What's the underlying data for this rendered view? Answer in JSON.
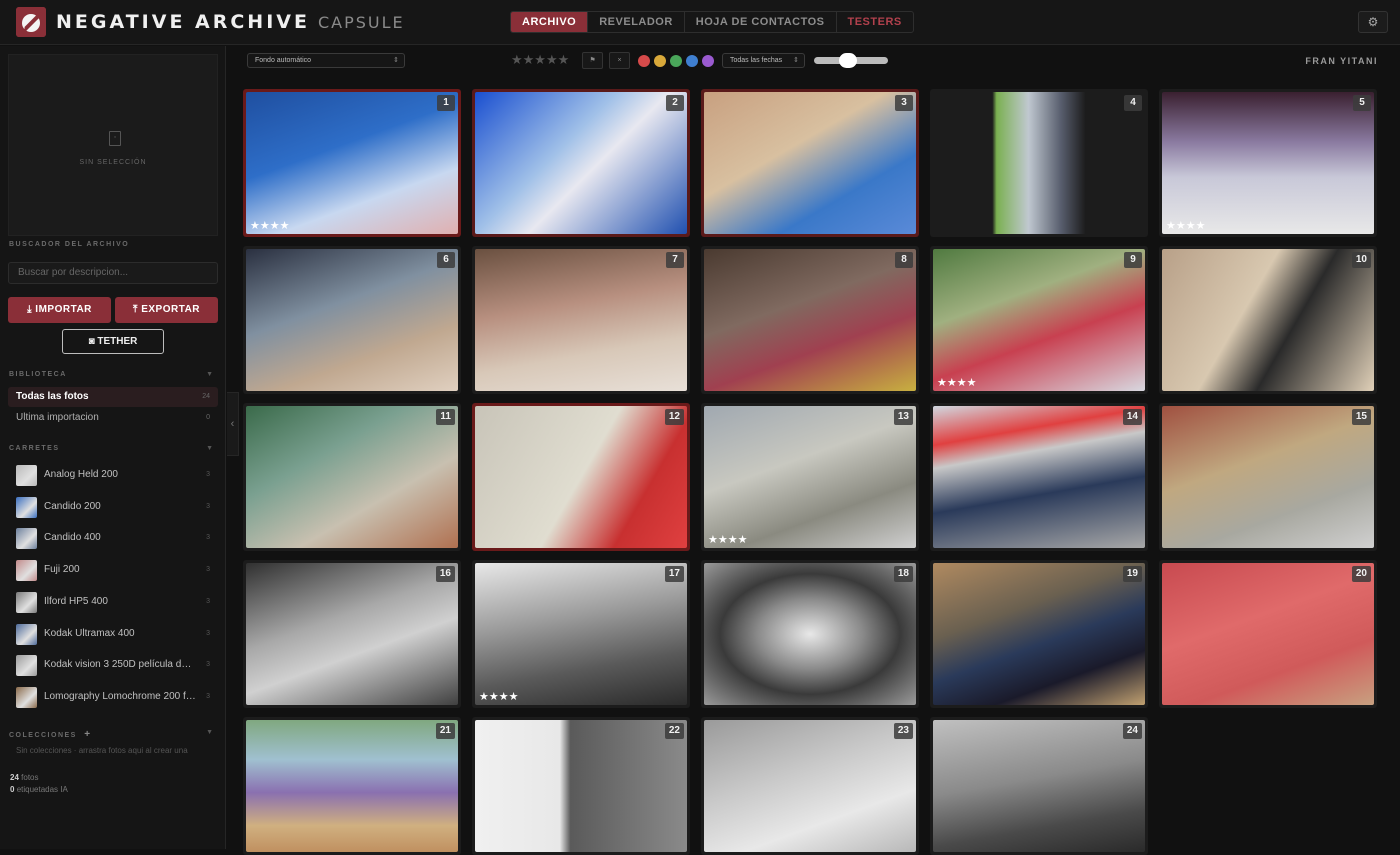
{
  "app": {
    "brand": "NEGATIVE ARCHIVE",
    "brand_sub": "CAPSULE"
  },
  "nav": {
    "tabs": [
      {
        "label": "ARCHIVO",
        "state": "active"
      },
      {
        "label": "REVELADOR",
        "state": "normal"
      },
      {
        "label": "HOJA DE CONTACTOS",
        "state": "normal"
      },
      {
        "label": "TESTERS",
        "state": "alert"
      }
    ]
  },
  "header": {
    "settings_icon": "⚙"
  },
  "sidebar": {
    "preview": {
      "empty_text": "SIN SELECCIÓN"
    },
    "search": {
      "label": "BUSCADOR DEL ARCHIVO",
      "placeholder": "Buscar por descripcion..."
    },
    "buttons": {
      "import": "IMPORTAR",
      "export": "EXPORTAR",
      "tether": "TETHER"
    },
    "library": {
      "label": "BIBLIOTECA",
      "items": [
        {
          "label": "Todas las fotos",
          "count": "24"
        },
        {
          "label": "Ultima importacion",
          "count": "0"
        }
      ]
    },
    "rolls": {
      "label": "CARRETES",
      "items": [
        {
          "name": "Analog Held 200",
          "count": "3",
          "color": "#b9b9b9"
        },
        {
          "name": "Candido 200",
          "count": "3",
          "color": "#3a6fc0"
        },
        {
          "name": "Candido 400",
          "count": "3",
          "color": "#6b7f9c"
        },
        {
          "name": "Fuji 200",
          "count": "3",
          "color": "#c28a8a"
        },
        {
          "name": "Ilford HP5 400",
          "count": "3",
          "color": "#7a7a7a"
        },
        {
          "name": "Kodak Ultramax 400",
          "count": "3",
          "color": "#4d6a9a"
        },
        {
          "name": "Kodak vision 3 250D película de cine",
          "count": "3",
          "color": "#9a9a9a"
        },
        {
          "name": "Lomography Lomochrome 200 formato 120",
          "count": "3",
          "color": "#8a6a4a"
        }
      ]
    },
    "collections": {
      "label": "COLECCIONES",
      "add": "+",
      "empty": "Sin colecciones · arrastra fotos aqui al crear una"
    },
    "stats": {
      "photos_count": "24",
      "photos_label": "fotos",
      "tagged_count": "0",
      "tagged_label": "etiquetadas IA"
    }
  },
  "toolbar": {
    "background_select": "Fondo automático",
    "stars": "★★★★★",
    "flag_icon": "⚑",
    "clear_icon": "×",
    "color_labels": [
      "#d64a4a",
      "#d9a93a",
      "#4aa65a",
      "#3f7fd0",
      "#9a5ad0"
    ],
    "date_select": "Todas las fechas",
    "zoom": 0.45,
    "user": "FRAN YITANI"
  },
  "photos": [
    {
      "n": "1",
      "rating": "★★★★",
      "bg": "linear-gradient(160deg,#1f4fa0 0%,#2e6ec8 40%,#c8d8f0 70%,#e0b0b0 100%)",
      "border": "#6a1a1a"
    },
    {
      "n": "2",
      "rating": "",
      "bg": "linear-gradient(135deg,#1a4fd0 0%,#a0c0e8 40%,#e8e8f0 55%,#2050b0 100%)",
      "border": "#5a1a1a"
    },
    {
      "n": "3",
      "rating": "",
      "bg": "linear-gradient(150deg,#c8a080 0%,#d8c0a0 40%,#3a78c8 70%,#5a8ad8 100%)",
      "border": "#5a1a1a"
    },
    {
      "n": "4",
      "rating": "",
      "bg": "linear-gradient(90deg,#1c1c1c 0%,#1c1c1c 28%,#7ab050 30%,#c0c8d0 45%,#5a6070 60%,#1c1c1c 72%,#1c1c1c 100%)",
      "border": "#1c1c1c"
    },
    {
      "n": "5",
      "rating": "★★★★",
      "bg": "linear-gradient(180deg,#3a2030 0%,#8a7aa0 35%,#c8c8d8 60%,#e8e8e8 100%)",
      "border": "#1c1c1c"
    },
    {
      "n": "6",
      "rating": "",
      "bg": "linear-gradient(160deg,#2a3040 0%,#8090a0 40%,#c0a890 70%,#e0d0c0 100%)",
      "border": "#1c1c1c"
    },
    {
      "n": "7",
      "rating": "",
      "bg": "linear-gradient(170deg,#6a5040 0%,#b89080 40%,#d8c8b8 70%,#e8e0d8 100%)",
      "border": "#1c1c1c"
    },
    {
      "n": "8",
      "rating": "",
      "bg": "linear-gradient(160deg,#4a3a30 0%,#806a60 40%,#a04050 65%,#c8b040 100%)",
      "border": "#1c1c1c"
    },
    {
      "n": "9",
      "rating": "★★★★",
      "bg": "linear-gradient(160deg,#507a40 0%,#a0b080 35%,#c84050 60%,#d8d8e0 100%)",
      "border": "#1c1c1c"
    },
    {
      "n": "10",
      "rating": "",
      "bg": "linear-gradient(120deg,#b8a088 0%,#d8c8b0 40%,#2a2a2a 60%,#e0d0b8 100%)",
      "border": "#1c1c1c"
    },
    {
      "n": "11",
      "rating": "",
      "bg": "linear-gradient(150deg,#3a6a4a 0%,#7aa090 35%,#c8c0b0 65%,#b07050 100%)",
      "border": "#1c1c1c"
    },
    {
      "n": "12",
      "rating": "",
      "bg": "linear-gradient(120deg,#c8c4b8 0%,#e0ddd0 50%,#c83030 75%,#e04040 100%)",
      "border": "#6a1a1a"
    },
    {
      "n": "13",
      "rating": "★★★★",
      "bg": "linear-gradient(160deg,#a0a8b0 0%,#c8c8c0 40%,#8a8a80 70%,#d0d0d0 100%)",
      "border": "#1c1c1c"
    },
    {
      "n": "14",
      "rating": "",
      "bg": "linear-gradient(170deg,#d0d8e0 0%,#e04040 22%,#c8c8c8 35%,#2a3a5a 60%,#a8a8a8 100%)",
      "border": "#1c1c1c"
    },
    {
      "n": "15",
      "rating": "",
      "bg": "linear-gradient(160deg,#a05040 0%,#c0a880 40%,#a8a8a0 70%,#d0d0d0 100%)",
      "border": "#1c1c1c"
    },
    {
      "n": "16",
      "rating": "",
      "bg": "linear-gradient(160deg,#303030 0%,#a8a8a8 40%,#d0d0d0 60%,#404040 100%)",
      "border": "#1c1c1c"
    },
    {
      "n": "17",
      "rating": "★★★★",
      "bg": "linear-gradient(170deg,#e8e8e8 0%,#9a9a9a 40%,#5a5a5a 70%,#2a2a2a 100%)",
      "border": "#1c1c1c"
    },
    {
      "n": "18",
      "rating": "",
      "bg": "radial-gradient(ellipse at 50% 50%,#e8e8e8 0%,#8a8a8a 35%,#3a3a3a 60%,#9a9a9a 100%)",
      "border": "#1c1c1c"
    },
    {
      "n": "19",
      "rating": "",
      "bg": "linear-gradient(160deg,#b08a60 0%,#6a6050 35%,#2a3a5a 55%,#1a1a2a 75%,#c0a070 100%)",
      "border": "#1c1c1c"
    },
    {
      "n": "20",
      "rating": "",
      "bg": "linear-gradient(160deg,#c84a50 0%,#e06a6a 40%,#d05a5a 70%,#c8a080 100%)",
      "border": "#1c1c1c"
    },
    {
      "n": "21",
      "rating": "",
      "bg": "linear-gradient(180deg,#80a880 0%,#a0c0d0 30%,#8a70b0 55%,#d0b080 80%,#c09060 100%)",
      "border": "#1c1c1c"
    },
    {
      "n": "22",
      "rating": "",
      "bg": "linear-gradient(90deg,#f0f0f0 0%,#e8e8e8 40%,#5a5a5a 45%,#8a8a8a 100%)",
      "border": "#1c1c1c"
    },
    {
      "n": "23",
      "rating": "",
      "bg": "linear-gradient(160deg,#9a9a9a 0%,#c8c8c8 40%,#e8e8e8 70%,#b8b8b8 100%)",
      "border": "#1c1c1c"
    },
    {
      "n": "24",
      "rating": "",
      "bg": "linear-gradient(170deg,#c0c0c0 0%,#8a8a8a 45%,#4a4a4a 75%,#2a2a2a 100%)",
      "border": "#1c1c1c"
    }
  ]
}
